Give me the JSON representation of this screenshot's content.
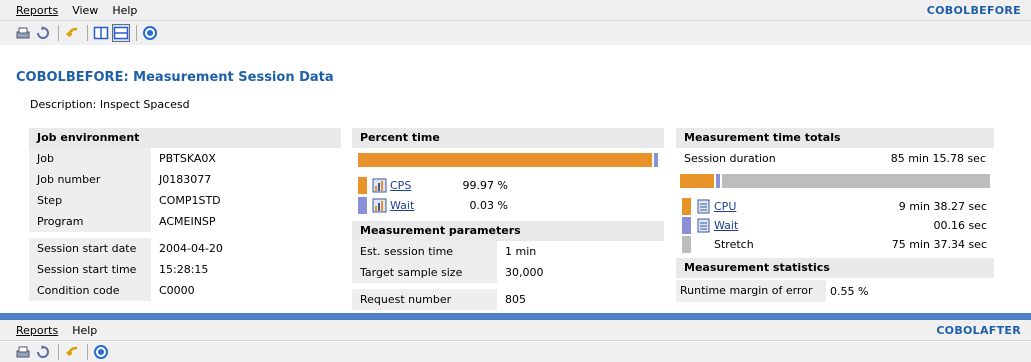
{
  "top_window": {
    "menu": [
      "Reports",
      "View",
      "Help"
    ],
    "title": "COBOLBEFORE"
  },
  "heading": "COBOLBEFORE: Measurement Session Data",
  "description": "Description: Inspect Spacesd",
  "job_environment": {
    "title": "Job environment",
    "rows": [
      {
        "key": "Job",
        "value": "PBTSKA0X"
      },
      {
        "key": "Job number",
        "value": "J0183077"
      },
      {
        "key": "Step",
        "value": "COMP1STD"
      },
      {
        "key": "Program",
        "value": "ACMEINSP"
      },
      {
        "key": "Session start date",
        "value": "2004-04-20"
      },
      {
        "key": "Session start time",
        "value": "15:28:15"
      },
      {
        "key": "Condition code",
        "value": "C0000"
      }
    ]
  },
  "percent_time": {
    "title": "Percent time",
    "cps_fraction": 0.9997,
    "items": [
      {
        "label": "CPS",
        "value": "99.97 %",
        "color": "#e8932a"
      },
      {
        "label": "Wait",
        "value": "0.03 %",
        "color": "#8b8fd6"
      }
    ]
  },
  "measurement_parameters": {
    "title": "Measurement parameters",
    "rows": [
      {
        "key": "Est. session time",
        "value": "1 min"
      },
      {
        "key": "Target sample size",
        "value": "30,000"
      },
      {
        "key": "Request number",
        "value": "805"
      }
    ]
  },
  "time_totals": {
    "title": "Measurement time totals",
    "session_label": "Session duration",
    "session_value": "85 min 15.78 sec",
    "bar_fractions": {
      "cpu": 0.113,
      "wait": 0.002,
      "stretch": 0.885
    },
    "items": [
      {
        "label": "CPU",
        "value": "9 min 38.27 sec",
        "color": "#e8932a",
        "link": true
      },
      {
        "label": "Wait",
        "value": "00.16 sec",
        "color": "#8b8fd6",
        "link": true
      },
      {
        "label": "Stretch",
        "value": "75 min 37.34 sec",
        "color": "#bdbdbd",
        "link": false
      }
    ]
  },
  "statistics": {
    "title": "Measurement statistics",
    "margin_label": "Runtime margin of error",
    "margin_value": "0.55 %"
  },
  "bottom_window": {
    "menu": [
      "Reports",
      "Help"
    ],
    "title": "COBOLAFTER"
  }
}
